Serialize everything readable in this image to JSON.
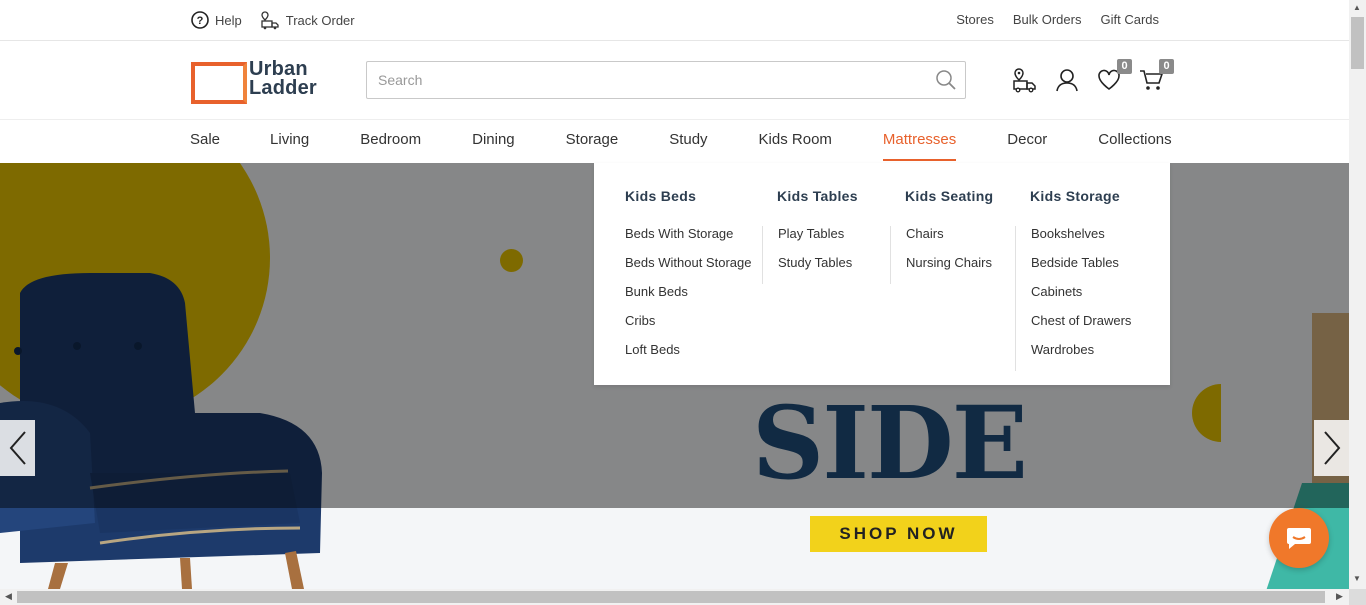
{
  "topbar": {
    "help": "Help",
    "track_order": "Track Order",
    "stores": "Stores",
    "bulk_orders": "Bulk Orders",
    "gift_cards": "Gift Cards"
  },
  "header": {
    "logo_line1": "Urban",
    "logo_line2": "Ladder",
    "search_placeholder": "Search",
    "wishlist_count": "0",
    "cart_count": "0"
  },
  "nav": {
    "items": [
      "Sale",
      "Living",
      "Bedroom",
      "Dining",
      "Storage",
      "Study",
      "Kids Room",
      "Mattresses",
      "Decor",
      "Collections"
    ],
    "active": "Mattresses"
  },
  "dropdown": {
    "columns": [
      {
        "heading": "Kids Beds",
        "items": [
          "Beds With Storage",
          "Beds Without Storage",
          "Bunk Beds",
          "Cribs",
          "Loft Beds"
        ]
      },
      {
        "heading": "Kids Tables",
        "items": [
          "Play Tables",
          "Study Tables"
        ]
      },
      {
        "heading": "Kids Seating",
        "items": [
          "Chairs",
          "Nursing Chairs"
        ]
      },
      {
        "heading": "Kids Storage",
        "items": [
          "Bookshelves",
          "Bedside Tables",
          "Cabinets",
          "Chest of Drawers",
          "Wardrobes"
        ]
      }
    ]
  },
  "hero": {
    "headline": "SIDE",
    "cta": "SHOP NOW"
  },
  "colors": {
    "accent": "#e8612c",
    "hero_yellow": "#e5c200",
    "headline_blue": "#1f4e7a",
    "cta_yellow": "#f2d21b",
    "chat_orange": "#f0782a"
  }
}
